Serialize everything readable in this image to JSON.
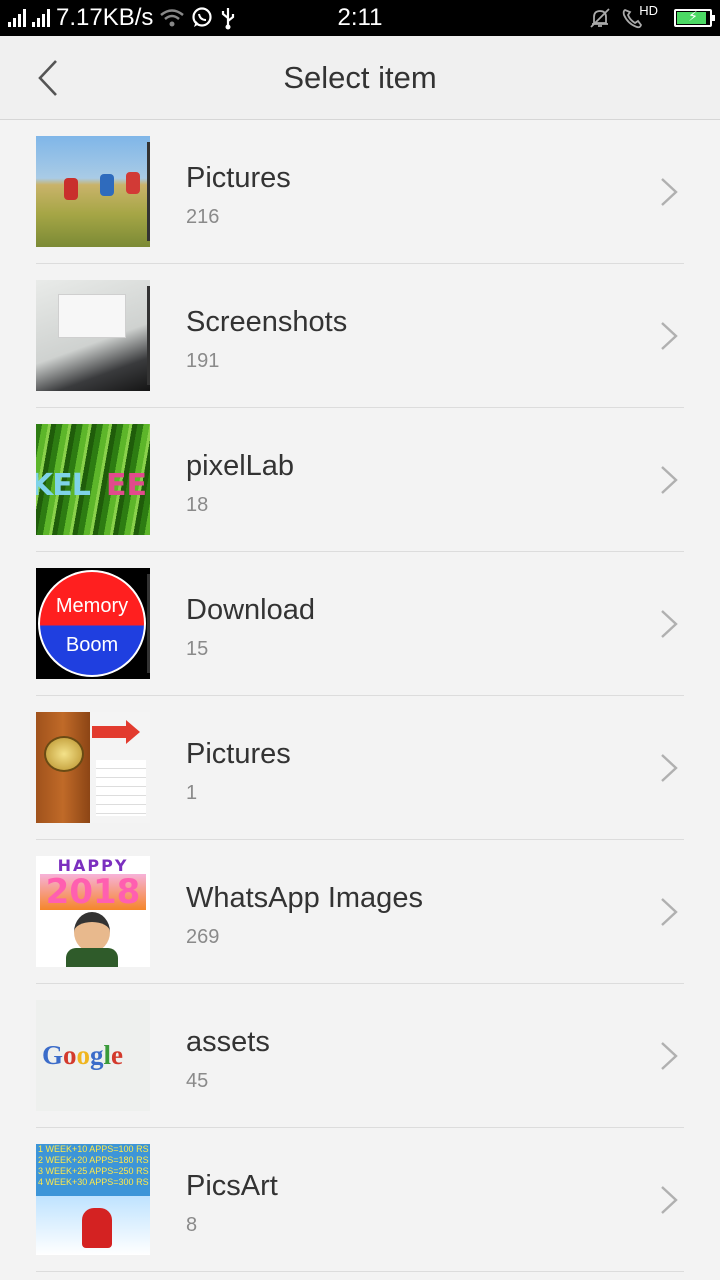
{
  "status_bar": {
    "net_speed": "7.17KB/s",
    "time": "2:11",
    "hd_label": "HD",
    "battery_level": 0.9,
    "icons": [
      "signal-icon",
      "signal-icon",
      "wifi-icon",
      "whatsapp-icon",
      "usb-icon",
      "mute-icon",
      "call-icon",
      "battery-icon"
    ]
  },
  "header": {
    "title": "Select item",
    "back_icon": "chevron-left-icon"
  },
  "albums": [
    {
      "name": "Pictures",
      "count": "216",
      "thumb": "field"
    },
    {
      "name": "Screenshots",
      "count": "191",
      "thumb": "screen"
    },
    {
      "name": "pixelLab",
      "count": "18",
      "thumb": "grass"
    },
    {
      "name": "Download",
      "count": "15",
      "thumb": "memory"
    },
    {
      "name": "Pictures",
      "count": "1",
      "thumb": "collage"
    },
    {
      "name": "WhatsApp Images",
      "count": "269",
      "thumb": "happy"
    },
    {
      "name": "assets",
      "count": "45",
      "thumb": "google"
    },
    {
      "name": "PicsArt",
      "count": "8",
      "thumb": "picsart"
    }
  ],
  "thumb_text": {
    "pixellab_left": "KEL",
    "pixellab_right": "EE",
    "memory_top": "Memory",
    "memory_bottom": "Boom",
    "happy_top": "HAPPY",
    "happy_year": "2018",
    "google": "Google",
    "picsart_lines": [
      "1 WEEK+10 APPS=100 RS",
      "2 WEEK+20 APPS=180 RS",
      "3 WEEK+25 APPS=250 RS",
      "4 WEEK+30 APPS=300 RS"
    ]
  }
}
